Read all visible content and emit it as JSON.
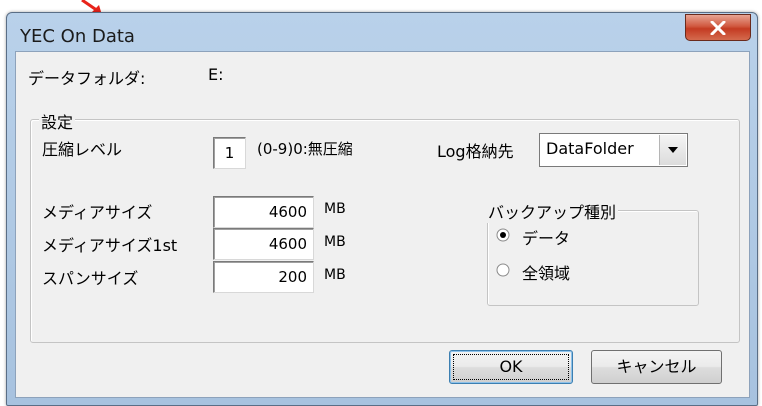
{
  "window": {
    "title": "YEC On Data",
    "close_glyph": "X"
  },
  "data_folder": {
    "label": "データフォルダ:",
    "value": "E:"
  },
  "settings": {
    "group_label": "設定",
    "compression_label": "圧縮レベル",
    "compression_value": "1",
    "compression_hint": "(0-9)0:無圧縮",
    "log_label": "Log格納先",
    "log_selected": "DataFolder",
    "media_size_label": "メディアサイズ",
    "media_size_value": "4600",
    "media_size_1st_label": "メディアサイズ1st",
    "media_size_1st_value": "4600",
    "span_size_label": "スパンサイズ",
    "span_size_value": "200",
    "unit": "MB"
  },
  "backup_type": {
    "group_label": "バックアップ種別",
    "options": [
      {
        "label": "データ",
        "selected": true
      },
      {
        "label": "全領域",
        "selected": false
      }
    ]
  },
  "buttons": {
    "ok": "OK",
    "cancel": "キャンセル"
  },
  "colors": {
    "titlebar": "#b9d1ea",
    "close_button": "#c43b22",
    "dialog_face": "#f0f0f0",
    "annotation_arrow": "#e8231a"
  },
  "icons": {
    "close": "close-icon",
    "dropdown": "chevron-down-icon",
    "annotation": "red-arrow-icon"
  }
}
